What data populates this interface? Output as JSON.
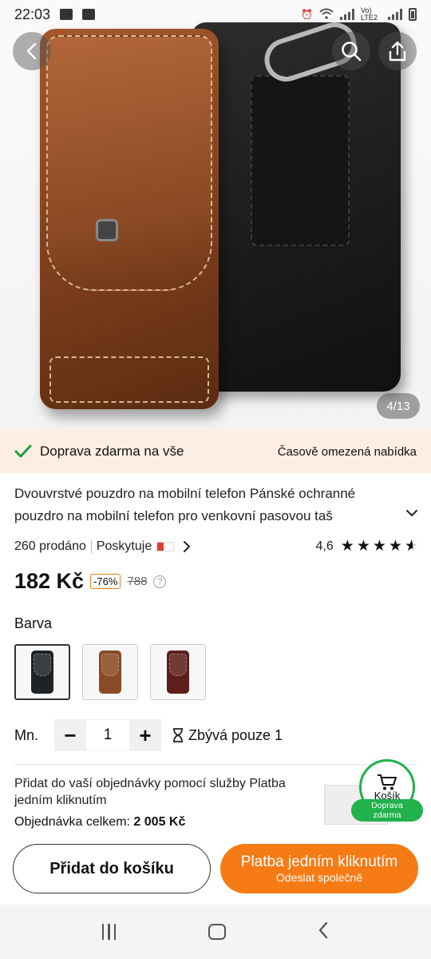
{
  "status_bar": {
    "time": "22:03",
    "network_label": "Vo) LTE2"
  },
  "gallery": {
    "counter": "4/13"
  },
  "shipping": {
    "free_label": "Doprava zdarma na vše",
    "offer_label": "Časově omezená nabídka"
  },
  "product": {
    "title": "Dvouvrstvé pouzdro na mobilní telefon Pánské ochranné pouzdro na mobilní telefon pro venkovní pasovou taš",
    "sold": "260 prodáno",
    "provider_label": "Poskytuje",
    "rating": "4,6",
    "rating_value": 4.6,
    "rating_max": 5,
    "price": "182 Kč",
    "discount": "-76%",
    "old_price": "788"
  },
  "color": {
    "label": "Barva",
    "options": [
      {
        "name": "black",
        "color": "#1f2328"
      },
      {
        "name": "brown",
        "color": "#8a4a25"
      },
      {
        "name": "wine",
        "color": "#5e1f1c"
      }
    ],
    "selected_index": 0
  },
  "quantity": {
    "label": "Mn.",
    "value": "1",
    "stock_text": "Zbývá pouze 1"
  },
  "one_click": {
    "text": "Přidat do vaší objednávky pomocí služby Platba jedním kliknutím",
    "total_label": "Objednávka celkem:",
    "total_value": "2 005 Kč"
  },
  "cart_badge": {
    "label": "Košík",
    "free_line1": "Doprava",
    "free_line2": "zdarma"
  },
  "buttons": {
    "add_to_cart": "Přidat do košíku",
    "pay_line1": "Platba jedním kliknutím",
    "pay_line2": "Odeslat společně"
  },
  "colors": {
    "accent": "#f77b14",
    "green": "#22b14c",
    "banner_bg": "#fdeee4"
  }
}
